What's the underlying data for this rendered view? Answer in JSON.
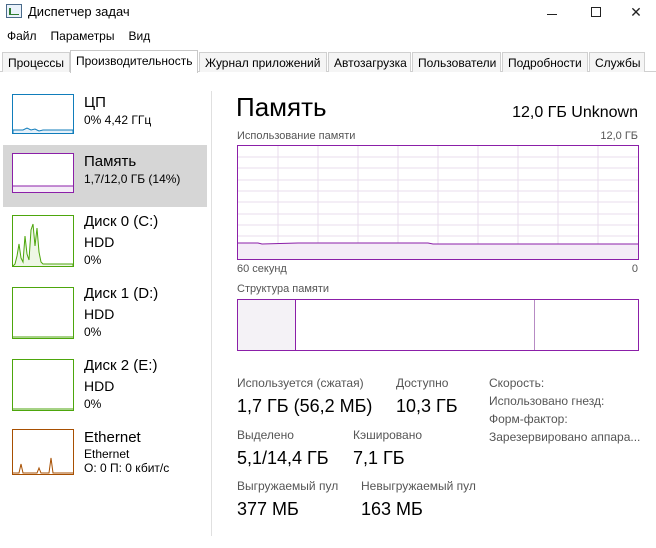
{
  "window": {
    "title": "Диспетчер задач"
  },
  "menu": [
    "Файл",
    "Параметры",
    "Вид"
  ],
  "tabs": [
    "Процессы",
    "Производительность",
    "Журнал приложений",
    "Автозагрузка",
    "Пользователи",
    "Подробности",
    "Службы"
  ],
  "sidebar": {
    "cpu": {
      "title": "ЦП",
      "line1": "0% 4,42 ГГц"
    },
    "memory": {
      "title": "Память",
      "line1": "1,7/12,0 ГБ (14%)"
    },
    "disk0": {
      "title": "Диск 0 (C:)",
      "line1": "HDD",
      "line2": "0%"
    },
    "disk1": {
      "title": "Диск 1 (D:)",
      "line1": "HDD",
      "line2": "0%"
    },
    "disk2": {
      "title": "Диск 2 (E:)",
      "line1": "HDD",
      "line2": "0%"
    },
    "ethernet": {
      "title": "Ethernet",
      "line1": "Ethernet",
      "line2": "О: 0 П: 0 кбит/с"
    }
  },
  "main": {
    "title": "Память",
    "total": "12,0 ГБ Unknown",
    "usage_label": "Использование памяти",
    "usage_max": "12,0 ГБ",
    "time_left": "60 секунд",
    "time_right": "0",
    "structure_label": "Структура памяти",
    "stats": {
      "in_use_label": "Используется (сжатая)",
      "in_use_value": "1,7 ГБ (56,2 МБ)",
      "available_label": "Доступно",
      "available_value": "10,3 ГБ",
      "committed_label": "Выделено",
      "committed_value": "5,1/14,4 ГБ",
      "cached_label": "Кэшировано",
      "cached_value": "7,1 ГБ",
      "paged_label": "Выгружаемый пул",
      "paged_value": "377 МБ",
      "nonpaged_label": "Невыгружаемый пул",
      "nonpaged_value": "163 МБ"
    },
    "specs": {
      "speed": "Скорость:",
      "slots": "Использовано гнезд:",
      "form": "Форм-фактор:",
      "reserved": "Зарезервировано аппара..."
    }
  },
  "colors": {
    "memory": "#8b1fa8",
    "cpu": "#117dbb",
    "disk": "#4da60c",
    "ethernet": "#a74f01"
  }
}
